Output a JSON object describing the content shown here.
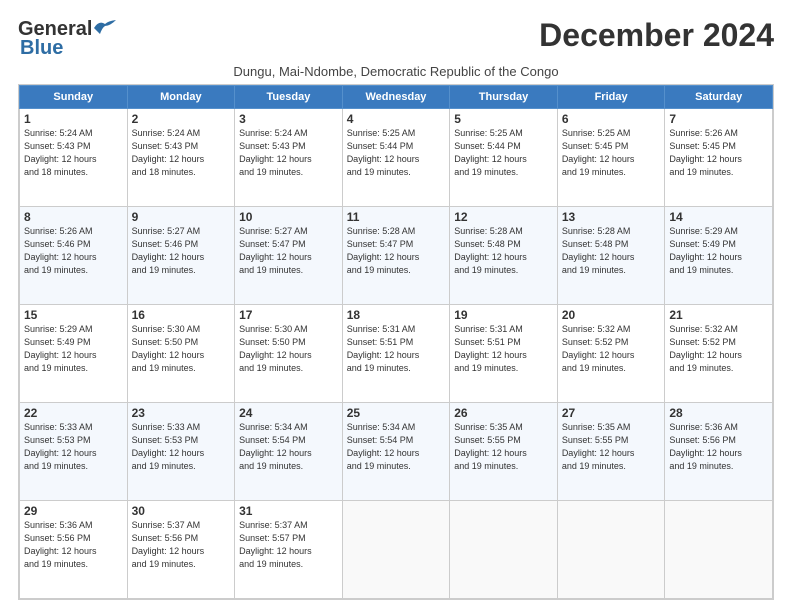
{
  "logo": {
    "line1": "General",
    "line2": "Blue"
  },
  "header": {
    "month": "December 2024",
    "location": "Dungu, Mai-Ndombe, Democratic Republic of the Congo"
  },
  "days_of_week": [
    "Sunday",
    "Monday",
    "Tuesday",
    "Wednesday",
    "Thursday",
    "Friday",
    "Saturday"
  ],
  "weeks": [
    [
      {
        "day": "1",
        "info": "Sunrise: 5:24 AM\nSunset: 5:43 PM\nDaylight: 12 hours\nand 18 minutes."
      },
      {
        "day": "2",
        "info": "Sunrise: 5:24 AM\nSunset: 5:43 PM\nDaylight: 12 hours\nand 18 minutes."
      },
      {
        "day": "3",
        "info": "Sunrise: 5:24 AM\nSunset: 5:43 PM\nDaylight: 12 hours\nand 19 minutes."
      },
      {
        "day": "4",
        "info": "Sunrise: 5:25 AM\nSunset: 5:44 PM\nDaylight: 12 hours\nand 19 minutes."
      },
      {
        "day": "5",
        "info": "Sunrise: 5:25 AM\nSunset: 5:44 PM\nDaylight: 12 hours\nand 19 minutes."
      },
      {
        "day": "6",
        "info": "Sunrise: 5:25 AM\nSunset: 5:45 PM\nDaylight: 12 hours\nand 19 minutes."
      },
      {
        "day": "7",
        "info": "Sunrise: 5:26 AM\nSunset: 5:45 PM\nDaylight: 12 hours\nand 19 minutes."
      }
    ],
    [
      {
        "day": "8",
        "info": "Sunrise: 5:26 AM\nSunset: 5:46 PM\nDaylight: 12 hours\nand 19 minutes."
      },
      {
        "day": "9",
        "info": "Sunrise: 5:27 AM\nSunset: 5:46 PM\nDaylight: 12 hours\nand 19 minutes."
      },
      {
        "day": "10",
        "info": "Sunrise: 5:27 AM\nSunset: 5:47 PM\nDaylight: 12 hours\nand 19 minutes."
      },
      {
        "day": "11",
        "info": "Sunrise: 5:28 AM\nSunset: 5:47 PM\nDaylight: 12 hours\nand 19 minutes."
      },
      {
        "day": "12",
        "info": "Sunrise: 5:28 AM\nSunset: 5:48 PM\nDaylight: 12 hours\nand 19 minutes."
      },
      {
        "day": "13",
        "info": "Sunrise: 5:28 AM\nSunset: 5:48 PM\nDaylight: 12 hours\nand 19 minutes."
      },
      {
        "day": "14",
        "info": "Sunrise: 5:29 AM\nSunset: 5:49 PM\nDaylight: 12 hours\nand 19 minutes."
      }
    ],
    [
      {
        "day": "15",
        "info": "Sunrise: 5:29 AM\nSunset: 5:49 PM\nDaylight: 12 hours\nand 19 minutes."
      },
      {
        "day": "16",
        "info": "Sunrise: 5:30 AM\nSunset: 5:50 PM\nDaylight: 12 hours\nand 19 minutes."
      },
      {
        "day": "17",
        "info": "Sunrise: 5:30 AM\nSunset: 5:50 PM\nDaylight: 12 hours\nand 19 minutes."
      },
      {
        "day": "18",
        "info": "Sunrise: 5:31 AM\nSunset: 5:51 PM\nDaylight: 12 hours\nand 19 minutes."
      },
      {
        "day": "19",
        "info": "Sunrise: 5:31 AM\nSunset: 5:51 PM\nDaylight: 12 hours\nand 19 minutes."
      },
      {
        "day": "20",
        "info": "Sunrise: 5:32 AM\nSunset: 5:52 PM\nDaylight: 12 hours\nand 19 minutes."
      },
      {
        "day": "21",
        "info": "Sunrise: 5:32 AM\nSunset: 5:52 PM\nDaylight: 12 hours\nand 19 minutes."
      }
    ],
    [
      {
        "day": "22",
        "info": "Sunrise: 5:33 AM\nSunset: 5:53 PM\nDaylight: 12 hours\nand 19 minutes."
      },
      {
        "day": "23",
        "info": "Sunrise: 5:33 AM\nSunset: 5:53 PM\nDaylight: 12 hours\nand 19 minutes."
      },
      {
        "day": "24",
        "info": "Sunrise: 5:34 AM\nSunset: 5:54 PM\nDaylight: 12 hours\nand 19 minutes."
      },
      {
        "day": "25",
        "info": "Sunrise: 5:34 AM\nSunset: 5:54 PM\nDaylight: 12 hours\nand 19 minutes."
      },
      {
        "day": "26",
        "info": "Sunrise: 5:35 AM\nSunset: 5:55 PM\nDaylight: 12 hours\nand 19 minutes."
      },
      {
        "day": "27",
        "info": "Sunrise: 5:35 AM\nSunset: 5:55 PM\nDaylight: 12 hours\nand 19 minutes."
      },
      {
        "day": "28",
        "info": "Sunrise: 5:36 AM\nSunset: 5:56 PM\nDaylight: 12 hours\nand 19 minutes."
      }
    ],
    [
      {
        "day": "29",
        "info": "Sunrise: 5:36 AM\nSunset: 5:56 PM\nDaylight: 12 hours\nand 19 minutes."
      },
      {
        "day": "30",
        "info": "Sunrise: 5:37 AM\nSunset: 5:56 PM\nDaylight: 12 hours\nand 19 minutes."
      },
      {
        "day": "31",
        "info": "Sunrise: 5:37 AM\nSunset: 5:57 PM\nDaylight: 12 hours\nand 19 minutes."
      },
      {
        "day": "",
        "info": ""
      },
      {
        "day": "",
        "info": ""
      },
      {
        "day": "",
        "info": ""
      },
      {
        "day": "",
        "info": ""
      }
    ]
  ]
}
